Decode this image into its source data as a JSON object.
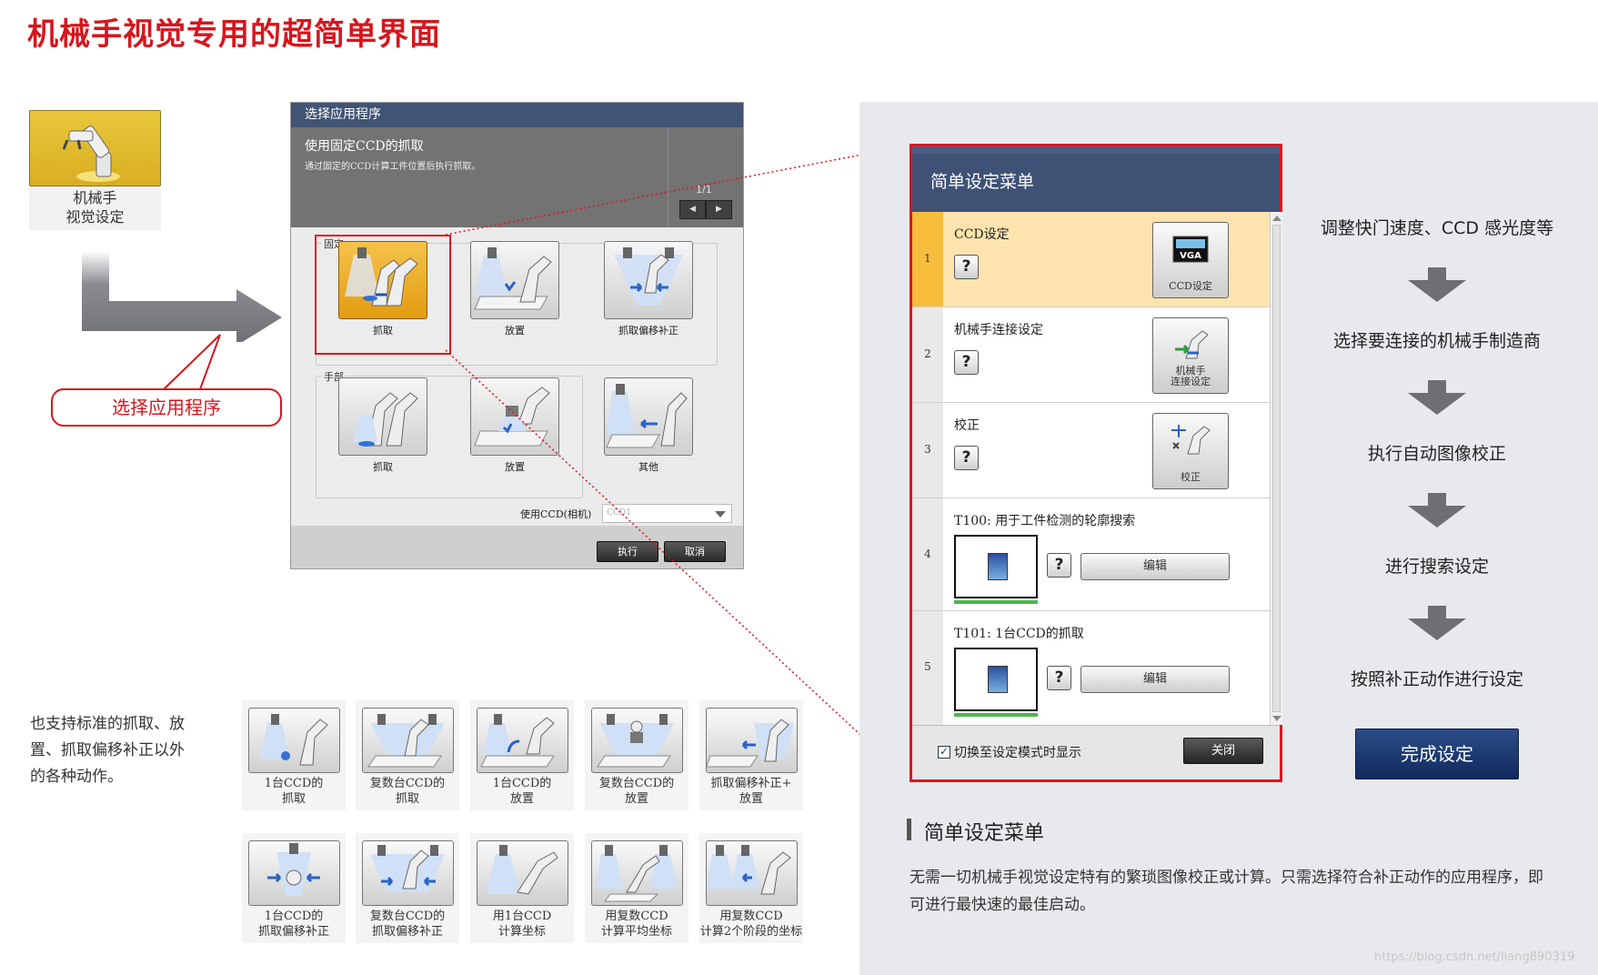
{
  "page": {
    "title": "机械手视觉专用的超简单界面"
  },
  "launcher": {
    "label_line1": "机械手",
    "label_line2": "视觉设定",
    "icon": "robot-arm-icon"
  },
  "callout": {
    "text": "选择应用程序"
  },
  "dialog": {
    "title": "选择应用程序",
    "desc_title": "使用固定CCD的抓取",
    "desc_detail": "通过固定的CCD计算工件位置后执行抓取。",
    "pager": "1/1",
    "prev_label": "◀",
    "next_label": "▶",
    "group_fixed": {
      "label": "固定",
      "items": [
        {
          "label": "抓取",
          "icon": "fixed-pick-icon",
          "selected": true
        },
        {
          "label": "放置",
          "icon": "fixed-place-icon",
          "selected": false
        },
        {
          "label": "抓取偏移补正",
          "icon": "fixed-pick-offset-icon",
          "selected": false
        }
      ]
    },
    "group_hand": {
      "label": "手部",
      "items": [
        {
          "label": "抓取",
          "icon": "hand-pick-icon"
        },
        {
          "label": "放置",
          "icon": "hand-place-icon"
        },
        {
          "label": "其他",
          "icon": "hand-other-icon"
        }
      ]
    },
    "ccd_label": "使用CCD(相机)",
    "ccd_value": "CCD1",
    "execute_label": "执行",
    "cancel_label": "取消"
  },
  "also_text": "也支持标准的抓取、放置、抓取偏移补正以外的各种动作。",
  "motions_row1": [
    {
      "line1": "1台CCD的",
      "line2": "抓取",
      "icon": "single-ccd-pick-icon"
    },
    {
      "line1": "复数台CCD的",
      "line2": "抓取",
      "icon": "multi-ccd-pick-icon"
    },
    {
      "line1": "1台CCD的",
      "line2": "放置",
      "icon": "single-ccd-place-icon"
    },
    {
      "line1": "复数台CCD的",
      "line2": "放置",
      "icon": "multi-ccd-place-icon"
    },
    {
      "line1": "抓取偏移补正+",
      "line2": "放置",
      "icon": "pick-offset-place-icon"
    }
  ],
  "motions_row2": [
    {
      "line1": "1台CCD的",
      "line2": "抓取偏移补正",
      "icon": "single-ccd-offset-icon"
    },
    {
      "line1": "复数台CCD的",
      "line2": "抓取偏移补正",
      "icon": "multi-ccd-offset-icon"
    },
    {
      "line1": "用1台CCD",
      "line2": "计算坐标",
      "icon": "single-ccd-coord-icon"
    },
    {
      "line1": "用复数CCD",
      "line2": "计算平均坐标",
      "icon": "multi-ccd-avg-coord-icon"
    },
    {
      "line1": "用复数CCD",
      "line2": "计算2个阶段的坐标",
      "icon": "multi-ccd-2stage-icon"
    }
  ],
  "menu": {
    "title": "简单设定菜单",
    "rows": [
      {
        "num": "1",
        "title": "CCD设定",
        "q": "?",
        "btn_label": "CCD设定",
        "btn_badge": "VGA",
        "icon": "vga-camera-icon"
      },
      {
        "num": "2",
        "title": "机械手连接设定",
        "q": "?",
        "btn_label": "机械手\n连接设定",
        "icon": "robot-connect-icon"
      },
      {
        "num": "3",
        "title": "校正",
        "q": "?",
        "btn_label": "校正",
        "icon": "calibration-icon"
      },
      {
        "num": "4",
        "title": "T100: 用于工件检测的轮廓搜索",
        "q": "?",
        "edit_label": "编辑"
      },
      {
        "num": "5",
        "title": "T101: 1台CCD的抓取",
        "q": "?",
        "edit_label": "编辑"
      }
    ],
    "checkbox_label": "切换至设定模式时显示",
    "checkbox_checked": true,
    "close_label": "关闭"
  },
  "steps": [
    "调整快门速度、CCD 感光度等",
    "选择要连接的机械手制造商",
    "执行自动图像校正",
    "进行搜索设定",
    "按照补正动作进行设定"
  ],
  "done_label": "完成设定",
  "section": {
    "title": "简单设定菜单",
    "text": "无需一切机械手视觉设定特有的繁琐图像校正或计算。只需选择符合补正动作的应用程序，即可进行最快速的最佳启动。"
  },
  "watermark": "https://blog.csdn.net/liang890319",
  "colors": {
    "accent_red": "#d6161e",
    "dialog_title": "#425474",
    "menu_active": "#fde4ae",
    "done_button": "#1c3a72"
  }
}
